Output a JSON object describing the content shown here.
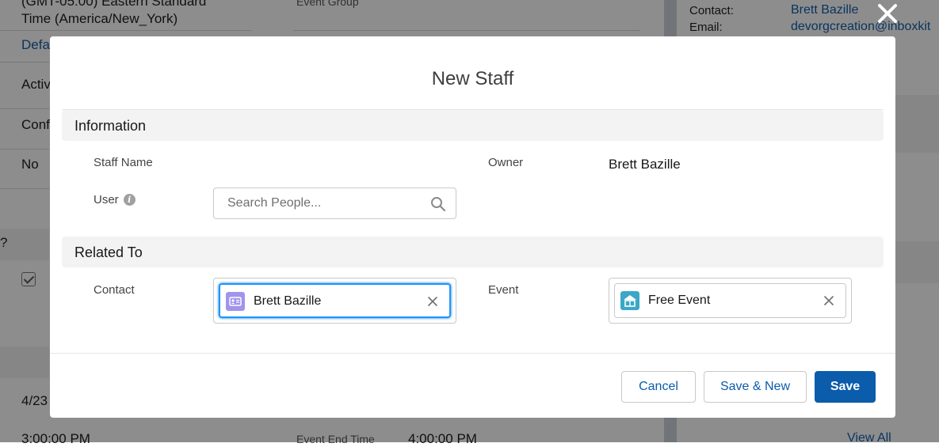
{
  "background": {
    "time_zone_line1": "(GMT-05:00) Eastern Standard",
    "time_zone_line2": "Time (America/New_York)",
    "event_group_label": "Event Group",
    "default_link": "Defa",
    "active_label": "Activ",
    "conf_label": "Conf",
    "no_value": "No",
    "question_mark": "?",
    "date_partial": "4/23",
    "start_time": "3:00:00 PM",
    "event_end_time_label": "Event End Time",
    "event_end_time_value": "4:00:00 PM",
    "contact_label": "Contact:",
    "contact_value": "Brett Bazille",
    "email_label": "Email:",
    "email_value": "devorgcreation@inboxkit",
    "view_all": "View All"
  },
  "modal": {
    "title": "New Staff",
    "sections": {
      "information": "Information",
      "related_to": "Related To"
    },
    "fields": {
      "staff_name_label": "Staff Name",
      "owner_label": "Owner",
      "owner_value": "Brett Bazille",
      "user_label": "User",
      "user_search_placeholder": "Search People...",
      "contact_label": "Contact",
      "contact_value": "Brett Bazille",
      "event_label": "Event",
      "event_value": "Free Event"
    },
    "buttons": {
      "cancel": "Cancel",
      "save_new": "Save & New",
      "save": "Save"
    }
  },
  "colors": {
    "brand": "#0b5cab",
    "contact_icon_bg": "#a094ed",
    "event_icon_bg": "#3ba8c6",
    "focus_border": "#1b96ff"
  },
  "icons": {
    "close": "close-icon",
    "info": "info-icon",
    "search": "search-icon",
    "contact": "contact-icon",
    "event": "event-icon",
    "remove": "remove-icon"
  }
}
